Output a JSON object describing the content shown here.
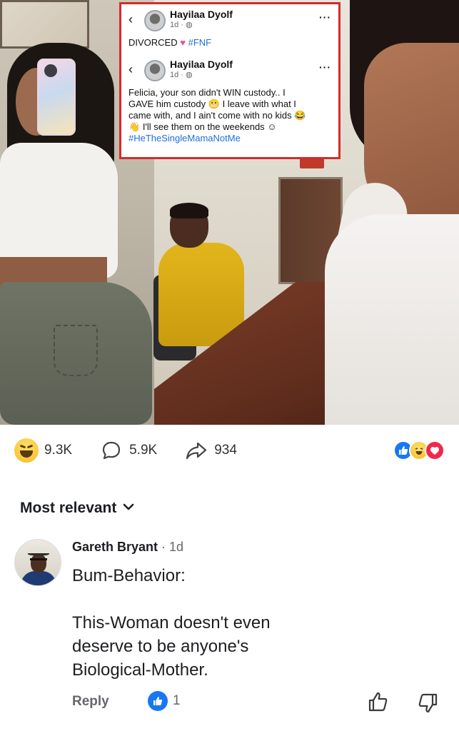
{
  "post_screenshot": {
    "first": {
      "author": "Hayilaa Dyolf",
      "time": "1d ·",
      "text_divorced": "DIVORCED",
      "hashtag": "#FNF"
    },
    "second": {
      "author": "Hayilaa Dyolf",
      "time": "1d ·",
      "line1": "Felicia, your son didn't WIN custody.. I",
      "line2a": "GAVE him custody",
      "line2b": "I leave with what I",
      "line3": "came with, and I ain't come with no kids",
      "line4": "I'll see them on the weekends",
      "hashtag": "#HeTheSingleMamaNotMe"
    },
    "border_color": "#d62b2b"
  },
  "stats": {
    "reactions": "9.3K",
    "comments": "5.9K",
    "shares": "934"
  },
  "sort": {
    "label": "Most relevant"
  },
  "comment": {
    "name": "Gareth Bryant",
    "time": "· 1d",
    "line1": "Bum-Behavior:",
    "line2": "This-Woman doesn't even",
    "line3": "deserve to be anyone's",
    "line4": "Biological-Mother.",
    "reply_label": "Reply",
    "like_count": "1"
  },
  "colors": {
    "like_blue": "#1877f2",
    "love_red": "#f0284a",
    "muted_text": "#65676b",
    "hashtag_blue": "#1e6fd9"
  },
  "icons": {
    "reaction_main": "haha-icon",
    "comments": "comment-bubble-icon",
    "shares": "share-arrow-icon",
    "sort": "chevron-down-icon",
    "comment_like": "thumbs-up-icon",
    "comment_dislike": "thumbs-down-icon"
  }
}
